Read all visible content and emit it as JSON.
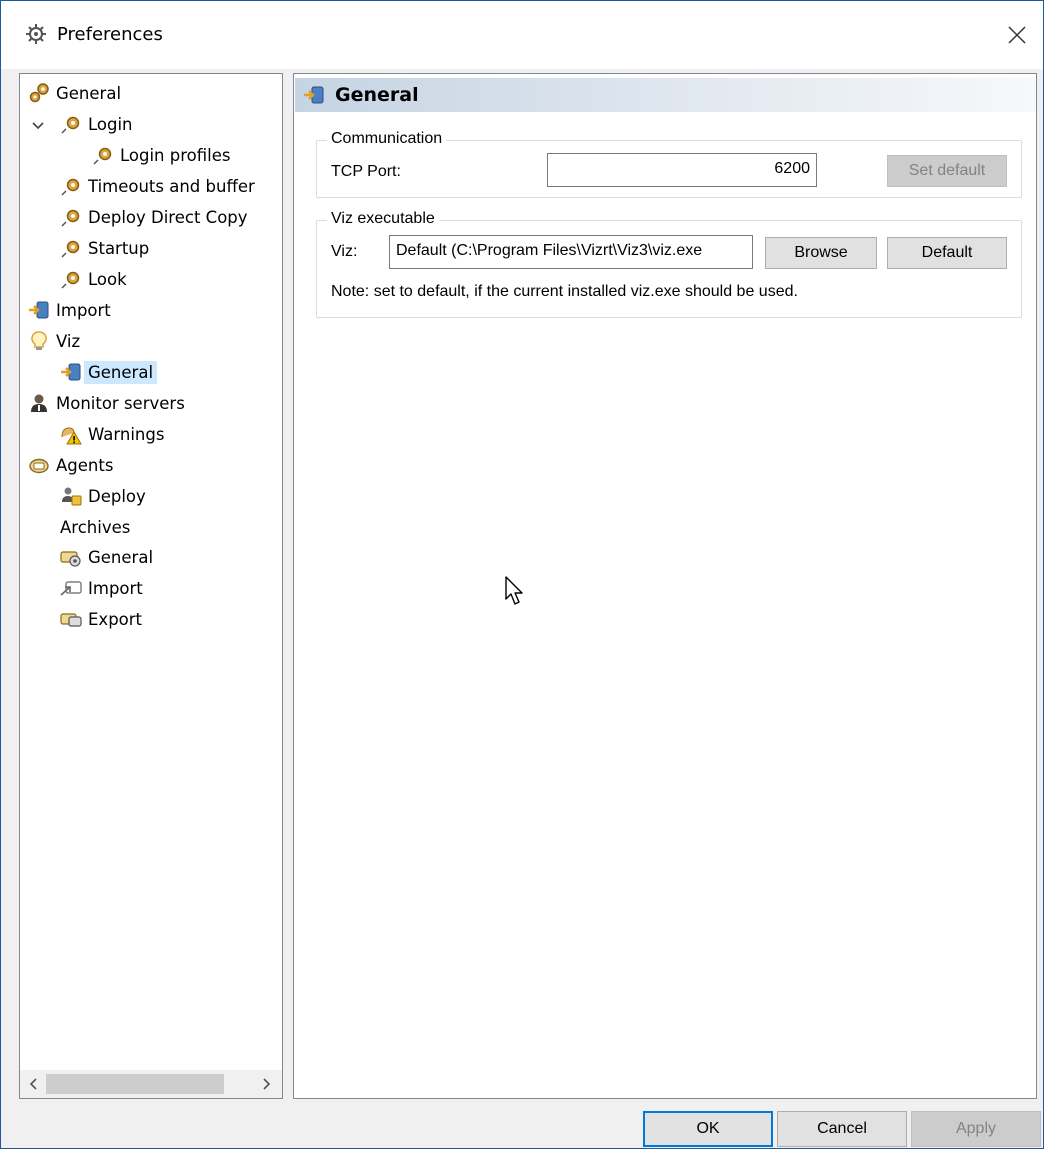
{
  "window": {
    "title": "Preferences",
    "icons": {
      "app": "gear-icon",
      "close": "close-icon"
    }
  },
  "tree": {
    "items": [
      {
        "label": "General",
        "icon": "gears-icon"
      },
      {
        "label": "Login",
        "icon": "gear-icon",
        "expanded": true
      },
      {
        "label": "Login profiles",
        "icon": "gear-icon"
      },
      {
        "label": "Timeouts and buffer",
        "icon": "gear-icon"
      },
      {
        "label": "Deploy Direct Copy",
        "icon": "gear-icon"
      },
      {
        "label": "Startup",
        "icon": "gear-icon"
      },
      {
        "label": "Look",
        "icon": "gear-icon"
      },
      {
        "label": "Import",
        "icon": "import-icon"
      },
      {
        "label": "Viz",
        "icon": "lightbulb-icon"
      },
      {
        "label": "General",
        "icon": "import-icon",
        "selected": true
      },
      {
        "label": "Monitor servers",
        "icon": "person-icon"
      },
      {
        "label": "Warnings",
        "icon": "warning-icon"
      },
      {
        "label": "Agents",
        "icon": "agent-icon"
      },
      {
        "label": "Deploy",
        "icon": "deploy-icon"
      },
      {
        "label": "Archives",
        "icon": ""
      },
      {
        "label": "General",
        "icon": "archive-settings-icon"
      },
      {
        "label": "Import",
        "icon": "archive-import-icon"
      },
      {
        "label": "Export",
        "icon": "archive-export-icon"
      }
    ]
  },
  "content": {
    "header": "General",
    "communication": {
      "legend": "Communication",
      "tcp_label": "TCP Port:",
      "tcp_value": "6200",
      "set_default": "Set default"
    },
    "viz_exec": {
      "legend": "Viz executable",
      "viz_label": "Viz:",
      "viz_value": "Default (C:\\Program Files\\Vizrt\\Viz3\\viz.exe",
      "browse": "Browse",
      "default": "Default",
      "note": "Note: set to default, if the current installed viz.exe should be used."
    }
  },
  "footer": {
    "ok": "OK",
    "cancel": "Cancel",
    "apply": "Apply"
  },
  "colors": {
    "accent": "#0078d7",
    "selection": "#cce8ff",
    "border": "#828790"
  }
}
